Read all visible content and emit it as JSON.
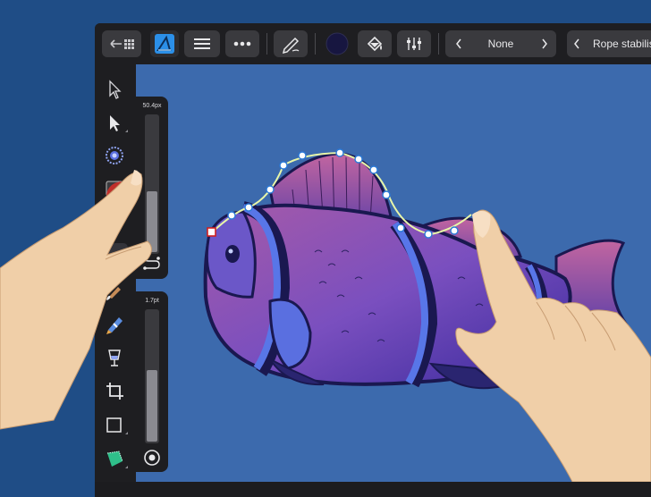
{
  "toolbar": {
    "back_icon": "back-arrow-grid-icon",
    "app_icon": "affinity-designer-icon",
    "menu_icon": "hamburger-icon",
    "more_icon": "ellipsis-icon",
    "pen_icon": "pen-icon",
    "color_swatch": "#171640",
    "fill_icon": "fill-bucket-icon",
    "adjust_icon": "sliders-icon",
    "stroke_value": "None",
    "stabiliser_label": "Rope stabilis"
  },
  "sliders": {
    "width_value": "50.4px",
    "width_level": 0.45,
    "stroke_value": "1.7pt",
    "stroke_level": 0.55
  },
  "tools": [
    {
      "name": "move-tool-icon"
    },
    {
      "name": "node-tool-icon"
    },
    {
      "name": "color-picker-tool-icon"
    },
    {
      "name": "gradient-tool-icon"
    },
    {
      "name": "pencil-tool-icon"
    },
    {
      "name": "brush-tool-icon"
    },
    {
      "name": "vector-brush-tool-icon"
    },
    {
      "name": "fill-tool-icon"
    },
    {
      "name": "crop-tool-icon"
    },
    {
      "name": "rectangle-tool-icon"
    },
    {
      "name": "shape-tool-icon"
    }
  ],
  "colors": {
    "background": "#1f4d86",
    "canvas": "#3c6aad",
    "chrome": "#1e1e21",
    "button": "#3a3a3e",
    "accent": "#2b8fe8"
  }
}
